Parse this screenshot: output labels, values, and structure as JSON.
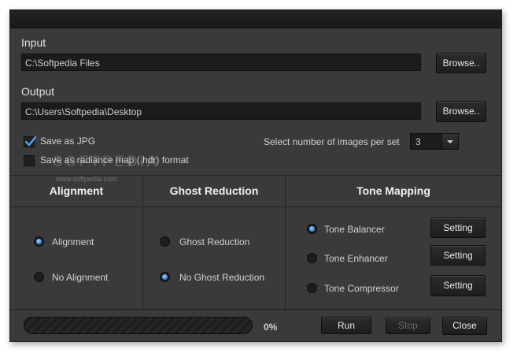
{
  "input": {
    "label": "Input",
    "path": "C:\\Softpedia Files",
    "browse_label": "Browse.."
  },
  "output": {
    "label": "Output",
    "path": "C:\\Users\\Softpedia\\Desktop",
    "browse_label": "Browse.."
  },
  "options": {
    "save_jpg_label": "Save as JPG",
    "save_jpg_checked": true,
    "save_hdr_label": "Save as radiance map (.hdr) format",
    "save_hdr_checked": false,
    "images_per_set_label": "Select number of images per set",
    "images_per_set_value": "3"
  },
  "watermark": {
    "logo": "SOFTPEDIA",
    "url": "www.softpedia.com"
  },
  "alignment": {
    "title": "Alignment",
    "options": [
      {
        "label": "Alignment",
        "selected": true
      },
      {
        "label": "No Alignment",
        "selected": false
      }
    ]
  },
  "ghost": {
    "title": "Ghost Reduction",
    "options": [
      {
        "label": "Ghost Reduction",
        "selected": false
      },
      {
        "label": "No Ghost Reduction",
        "selected": true
      }
    ]
  },
  "tone": {
    "title": "Tone Mapping",
    "options": [
      {
        "label": "Tone Balancer",
        "selected": true,
        "setting_label": "Setting"
      },
      {
        "label": "Tone Enhancer",
        "selected": false,
        "setting_label": "Setting"
      },
      {
        "label": "Tone Compressor",
        "selected": false,
        "setting_label": "Setting"
      }
    ]
  },
  "footer": {
    "progress_text": "0%",
    "progress_fraction": 0,
    "run_label": "Run",
    "stop_label": "Stop",
    "close_label": "Close"
  },
  "colors": {
    "accent_radio": "#2a7fd8",
    "window_bg": "#3a3a3a",
    "field_bg": "#1c1c1c"
  }
}
